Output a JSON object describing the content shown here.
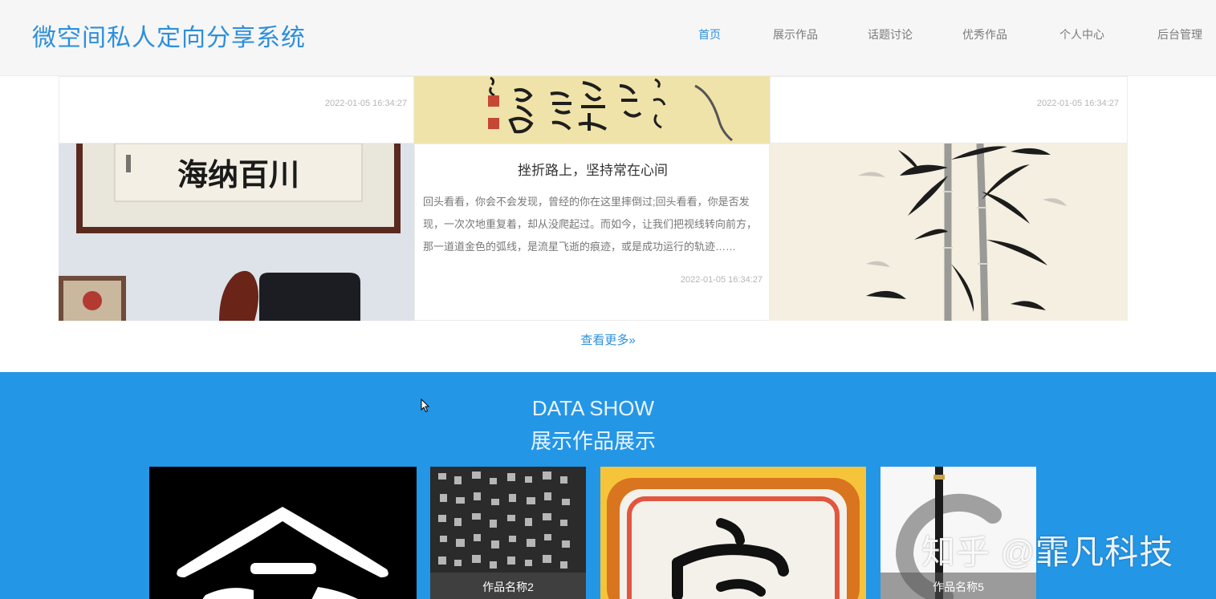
{
  "header": {
    "title": "微空间私人定向分享系统",
    "nav": [
      {
        "label": "首页",
        "active": true
      },
      {
        "label": "展示作品",
        "active": false
      },
      {
        "label": "话题讨论",
        "active": false
      },
      {
        "label": "优秀作品",
        "active": false
      },
      {
        "label": "个人中心",
        "active": false
      },
      {
        "label": "后台管理",
        "active": false
      }
    ]
  },
  "grid": {
    "top_left_date": "2022-01-05 16:34:27",
    "top_right_date": "2022-01-05 16:34:27",
    "article": {
      "title": "挫折路上，坚持常在心间",
      "body": "回头看看，你会不会发现，曾经的你在这里摔倒过;回头看看，你是否发现，一次次地重复着，却从没爬起过。而如今，让我们把视线转向前方，那一道道金色的弧线，是流星飞逝的痕迹，或是成功运行的轨迹……",
      "date": "2022-01-05 16:34:27"
    },
    "calligraphy_text": "海纳百川"
  },
  "view_more": "查看更多»",
  "data_show": {
    "title": "DATA SHOW",
    "subtitle": "展示作品展示",
    "cards": [
      {
        "caption": ""
      },
      {
        "caption": "作品名称2"
      },
      {
        "caption": ""
      },
      {
        "caption": "作品名称5"
      }
    ]
  },
  "watermark": "知乎 @霏凡科技",
  "colors": {
    "accent": "#2c8fdc",
    "section_blue": "#2496e6"
  }
}
